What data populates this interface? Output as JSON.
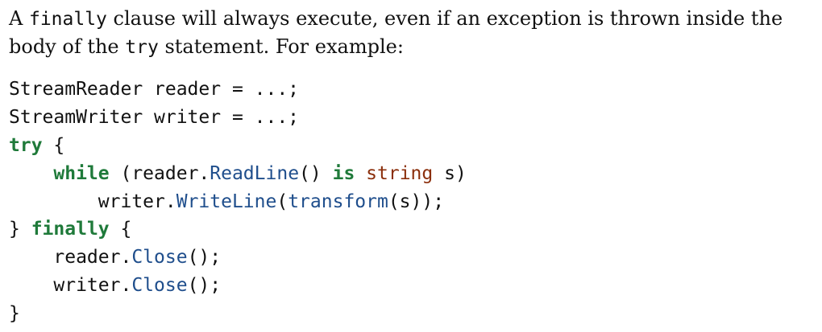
{
  "paragraph": {
    "p1": "A ",
    "kw_finally": "finally",
    "p2": " clause will always execute, even if an exception is thrown inside the body of the ",
    "kw_try": "try",
    "p3": " statement. For example:"
  },
  "code": {
    "l1": "StreamReader reader = ...;",
    "l2": "StreamWriter writer = ...;",
    "l3_kw": "try",
    "l3_rest": " {",
    "l4_indent": "    ",
    "l4_kw_while": "while",
    "l4_a": " (reader.",
    "l4_fn": "ReadLine",
    "l4_b": "() ",
    "l4_kw_is": "is",
    "l4_c": " ",
    "l4_ty": "string",
    "l4_d": " s)",
    "l5_a": "        writer.",
    "l5_fn1": "WriteLine",
    "l5_b": "(",
    "l5_fn2": "transform",
    "l5_c": "(s));",
    "l6_a": "} ",
    "l6_kw": "finally",
    "l6_b": " {",
    "l7_a": "    reader.",
    "l7_fn": "Close",
    "l7_b": "();",
    "l8_a": "    writer.",
    "l8_fn": "Close",
    "l8_b": "();",
    "l9": "}"
  },
  "colors": {
    "keyword": "#1f7a3a",
    "method": "#1f4e8c",
    "type": "#8b2f0c",
    "text": "#111111"
  }
}
